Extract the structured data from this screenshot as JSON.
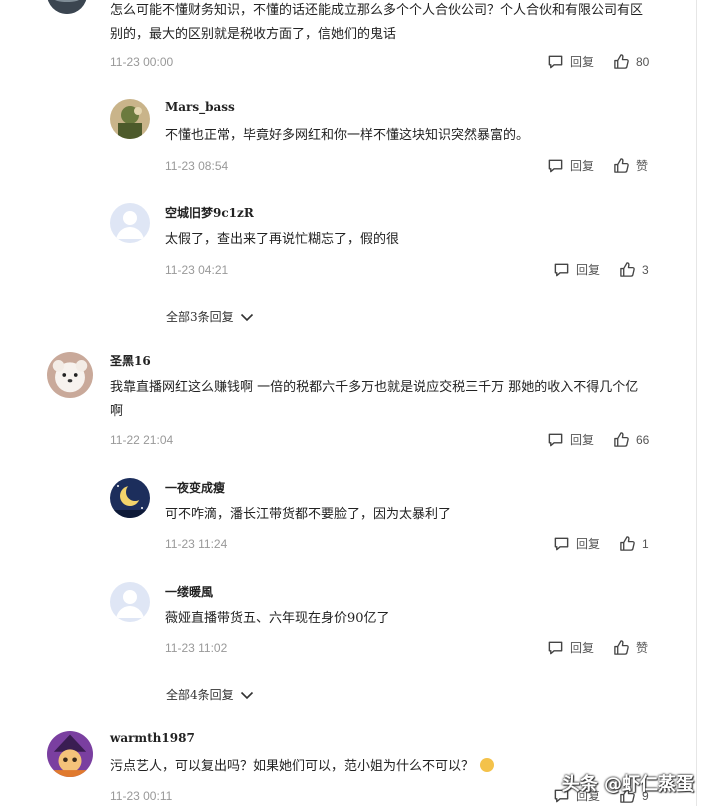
{
  "comments": [
    {
      "text": "怎么可能不懂财务知识，不懂的话还能成立那么多个个人合伙公司？个人合伙和有限公司有区别的，最大的区别就是税收方面了，信她们的鬼话",
      "time": "11-23 00:00",
      "reply_label": "回复",
      "like_count": "80"
    },
    {
      "username": "Mars_bass",
      "text": "不懂也正常，毕竟好多网红和你一样不懂这块知识突然暴富的。",
      "time": "11-23 08:54",
      "reply_label": "回复",
      "like_count": "赞"
    },
    {
      "username": "空城旧梦9c1zR",
      "text": "太假了，查出来了再说忙糊忘了，假的很",
      "time": "11-23 04:21",
      "reply_label": "回复",
      "like_count": "3"
    },
    {
      "username": "圣黑16",
      "text": "我靠直播网红这么赚钱啊 一倍的税都六千多万也就是说应交税三千万 那她的收入不得几个亿啊",
      "time": "11-22 21:04",
      "reply_label": "回复",
      "like_count": "66"
    },
    {
      "username": "一夜变成瘦",
      "text": "可不咋滴，潘长江带货都不要脸了，因为太暴利了",
      "time": "11-23 11:24",
      "reply_label": "回复",
      "like_count": "1"
    },
    {
      "username": "一缕暖風",
      "text": "薇娅直播带货五、六年现在身价90亿了",
      "time": "11-23 11:02",
      "reply_label": "回复",
      "like_count": "赞"
    },
    {
      "username": "warmth1987",
      "text": "污点艺人，可以复出吗？如果她们可以，范小姐为什么不可以？",
      "time": "11-23 00:11",
      "reply_label": "回复",
      "like_count": "9"
    }
  ],
  "expand_links": {
    "first": "全部3条回复",
    "second": "全部4条回复"
  },
  "icons": {
    "reply": "comment-bubble-icon",
    "like": "thumbs-up-icon",
    "expand": "chevron-down-icon"
  },
  "watermark": "头条 @虾仁蒸蛋"
}
